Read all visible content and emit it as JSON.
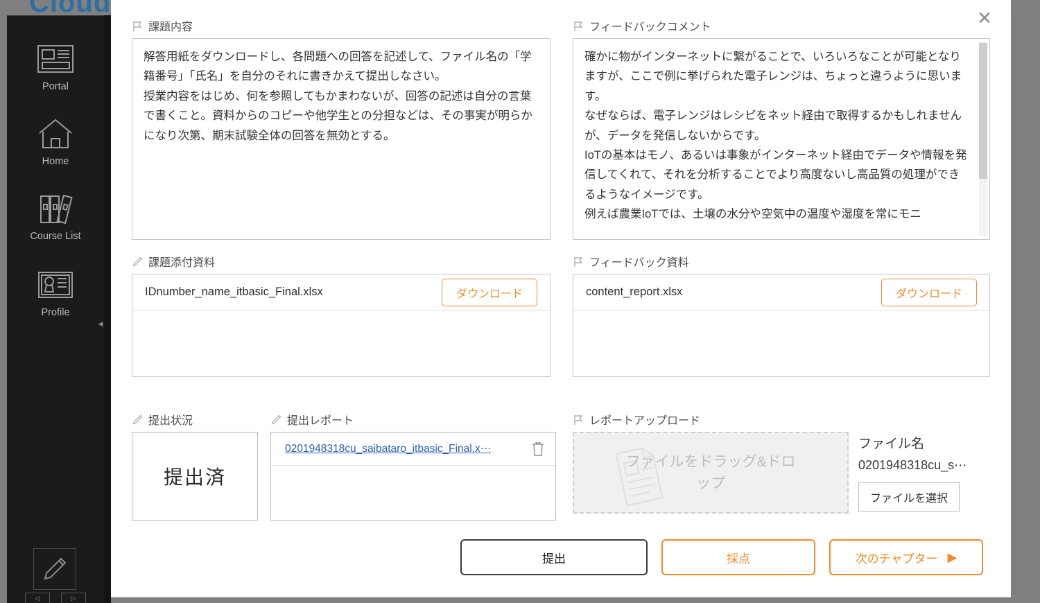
{
  "background": {
    "brand": "Cloud C"
  },
  "sidebar": {
    "items": [
      {
        "label": "Portal",
        "icon": "portal-icon"
      },
      {
        "label": "Home",
        "icon": "home-icon"
      },
      {
        "label": "Course List",
        "icon": "books-icon"
      },
      {
        "label": "Profile",
        "icon": "id-card-icon"
      }
    ],
    "pencil_icon": "pencil-icon",
    "prev_arrow": "◁",
    "next_arrow": "▷",
    "collapse_arrow": "◀"
  },
  "modal": {
    "close_label": "✕",
    "assignment_content": {
      "label": "課題内容",
      "icon": "flag-icon",
      "text": "解答用紙をダウンロードし、各問題への回答を記述して、ファイル名の「学籍番号」「氏名」を自分のそれに書きかえて提出しなさい。\n授業内容をはじめ、何を参照してもかまわないが、回答の記述は自分の言葉で書くこと。資料からのコピーや他学生との分担などは、その事実が明らかになり次第、期末試験全体の回答を無効とする。"
    },
    "feedback_comment": {
      "label": "フィードバックコメント",
      "icon": "flag-icon",
      "text": "確かに物がインターネットに繋がることで、いろいろなことが可能となりますが、ここで例に挙げられた電子レンジは、ちょっと違うように思います。\nなぜならば、電子レンジはレシピをネット経由で取得するかもしれませんが、データを発信しないからです。\nIoTの基本はモノ、あるいは事象がインターネット経由でデータや情報を発信してくれて、それを分析することでより高度ないし高品質の処理ができるようなイメージです。\n例えば農業IoTでは、土壌の水分や空気中の温度や湿度を常にモニ"
    },
    "assignment_attachment": {
      "label": "課題添付資料",
      "icon": "pencil-icon",
      "file_name": "IDnumber_name_itbasic_Final.xlsx",
      "download_label": "ダウンロード"
    },
    "feedback_attachment": {
      "label": "フィードバック資料",
      "icon": "flag-icon",
      "file_name": "content_report.xlsx",
      "download_label": "ダウンロード"
    },
    "submission_status": {
      "label": "提出状況",
      "icon": "pencil-icon",
      "status": "提出済"
    },
    "submitted_report": {
      "label": "提出レポート",
      "icon": "pencil-icon",
      "file_link": "0201948318cu_saibataro_itbasic_Final.x⋯",
      "delete_icon": "trash-icon"
    },
    "report_upload": {
      "label": "レポートアップロード",
      "icon": "flag-icon",
      "dropzone_text": "ファイルをドラッグ&ドロップ",
      "dropzone_icon": "document-icon",
      "file_name_title": "ファイル名",
      "file_name_value": "0201948318cu_s⋯",
      "choose_label": "ファイルを選択"
    },
    "actions": {
      "submit_label": "提出",
      "grade_label": "採点",
      "next_label": "次のチャプター",
      "next_caret": "▶"
    }
  },
  "colors": {
    "accent_orange": "#ef8c2e",
    "link_blue": "#2b5fb6",
    "sidebar_bg": "#1c1a1a",
    "page_bg": "#7f7f7f"
  }
}
